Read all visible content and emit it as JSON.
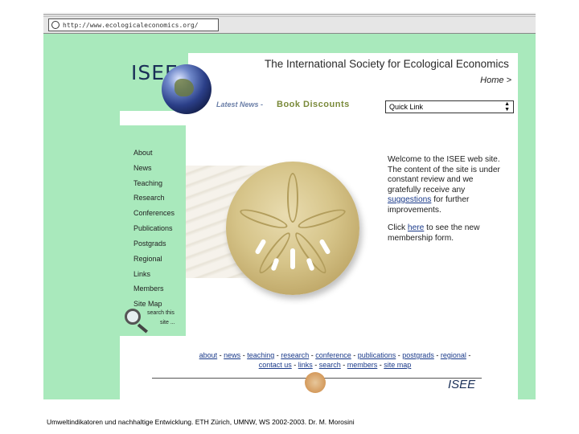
{
  "browser": {
    "address": "http://www.ecologicaleconomics.org/"
  },
  "header": {
    "logo": "ISEE",
    "title": "The International Society for Ecological Economics",
    "home": "Home >",
    "latest_news": "Latest News -",
    "book_discounts": "Book Discounts",
    "quick_link": "Quick Link"
  },
  "nav": {
    "items": [
      "About",
      "News",
      "Teaching",
      "Research",
      "Conferences",
      "Publications",
      "Postgrads",
      "Regional",
      "Links",
      "Members",
      "Site Map"
    ],
    "search_line1": "search this",
    "search_line2": "site ..."
  },
  "welcome": {
    "p1_before": "Welcome to the ISEE web site. The content of the site is under constant review and we gratefully receive any",
    "p1_link": "suggestions",
    "p1_after": "for further improvements.",
    "p2_before": "Click",
    "p2_link": "here",
    "p2_after": "to see the new membership form."
  },
  "footer": {
    "links_row1": [
      "about",
      "news",
      "teaching",
      "research",
      "conference",
      "publications",
      "postgrads",
      "regional"
    ],
    "links_row2": [
      "contact us",
      "links",
      "search",
      "members",
      "site map"
    ],
    "logo": "ISEE"
  },
  "caption": "Umweltindikatoren und nachhaltige Entwicklung. ETH Zürich, UMNW, WS 2002-2003. Dr. M. Morosini"
}
